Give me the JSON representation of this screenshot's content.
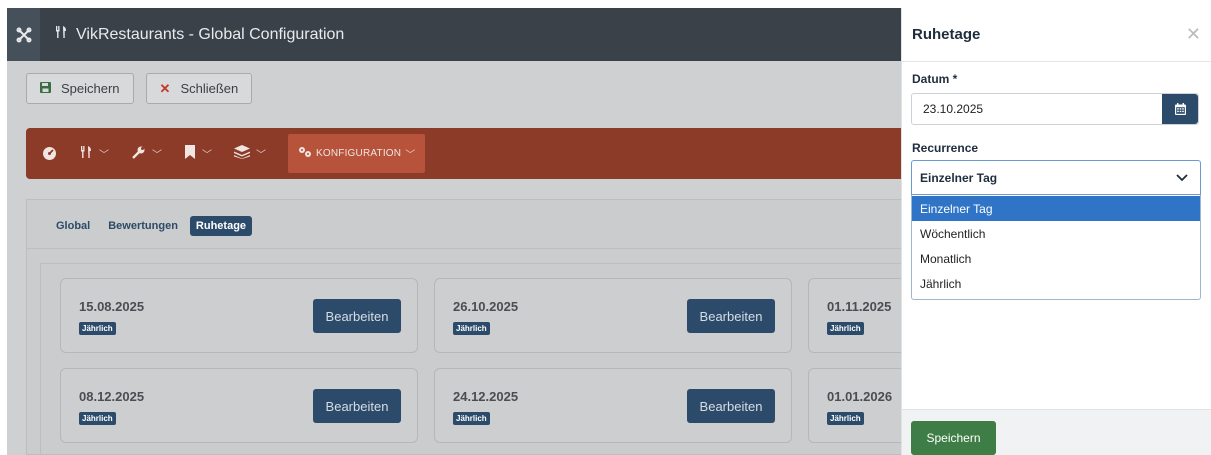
{
  "header": {
    "app_title": "VikRestaurants - Global Configuration"
  },
  "toolbar": {
    "save_label": "Speichern",
    "close_label": "Schließen"
  },
  "nav": {
    "active_label": "KONFIGURATION"
  },
  "tabs": [
    {
      "label": "Global",
      "active": false
    },
    {
      "label": "Bewertungen",
      "active": false
    },
    {
      "label": "Ruhetage",
      "active": true
    }
  ],
  "cards": [
    {
      "date": "15.08.2025",
      "badge": "Jährlich",
      "button": "Bearbeiten"
    },
    {
      "date": "26.10.2025",
      "badge": "Jährlich",
      "button": "Bearbeiten"
    },
    {
      "date": "01.11.2025",
      "badge": "Jährlich",
      "button": ""
    },
    {
      "date": "08.12.2025",
      "badge": "Jährlich",
      "button": "Bearbeiten"
    },
    {
      "date": "24.12.2025",
      "badge": "Jährlich",
      "button": "Bearbeiten"
    },
    {
      "date": "01.01.2026",
      "badge": "Jährlich",
      "button": ""
    }
  ],
  "drawer": {
    "title": "Ruhetage",
    "date_label": "Datum *",
    "date_value": "23.10.2025",
    "recurrence_label": "Recurrence",
    "recurrence_value": "Einzelner Tag",
    "options": [
      "Einzelner Tag",
      "Wöchentlich",
      "Monatlich",
      "Jährlich"
    ],
    "save_label": "Speichern"
  },
  "colors": {
    "accent_nav": "#8b3b28",
    "primary": "#2c4b6b",
    "save_green": "#3f7d46",
    "selected_option": "#2f74c6"
  }
}
